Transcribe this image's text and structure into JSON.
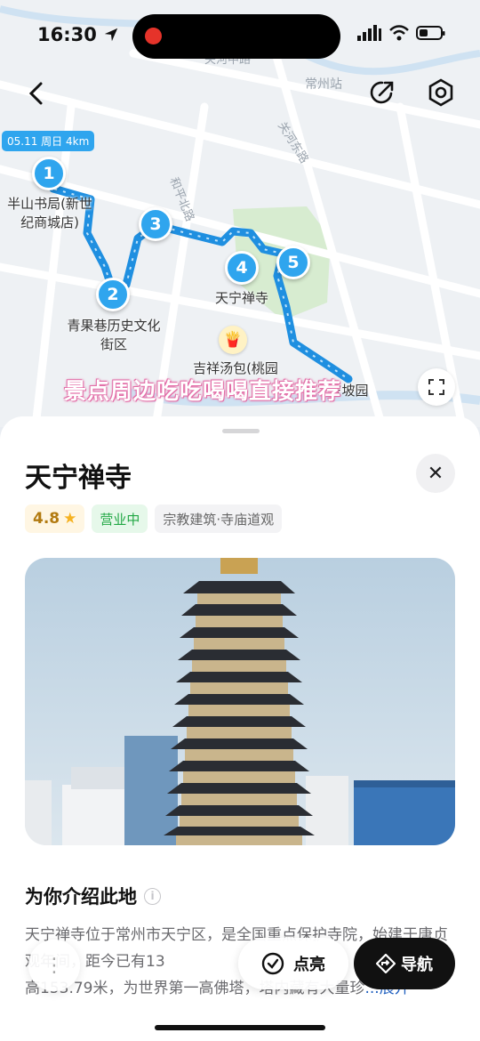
{
  "status_bar": {
    "time": "16:30"
  },
  "map": {
    "station_label": "常州站",
    "road_labels": [
      "和平北路",
      "关河东路",
      "关河中路"
    ],
    "route_tag": "05.11 周日 4km",
    "stops": [
      {
        "number": "1",
        "label": "半山书局(新世纪商城店)"
      },
      {
        "number": "2",
        "label": "青果巷历史文化街区"
      },
      {
        "number": "3",
        "label": ""
      },
      {
        "number": "4",
        "label": "天宁禅寺"
      },
      {
        "number": "5",
        "label": ""
      }
    ],
    "poi_food": "吉祥汤包(桃园",
    "poi_end": "东坡园",
    "caption": "景点周边吃吃喝喝直接推荐"
  },
  "place": {
    "title": "天宁禅寺",
    "rating": "4.8",
    "status": "营业中",
    "category": "宗教建筑·寺庙道观",
    "section_title": "为你介绍此地",
    "description": "天宁禅寺位于常州市天宁区，是全国重点保护寺院，始建于唐贞观年间，距今已有13",
    "description_2": "高153.79米，为世界第一高佛塔，塔内藏有大量珍",
    "more_label": "...展开"
  },
  "actions": {
    "checkin": "点亮",
    "navigate": "导航"
  },
  "icons": [
    "back-icon",
    "share-icon",
    "settings-icon",
    "close-icon",
    "star-icon",
    "info-icon",
    "more-dots-icon",
    "check-icon",
    "navigation-icon",
    "expand-icon",
    "food-icon"
  ]
}
